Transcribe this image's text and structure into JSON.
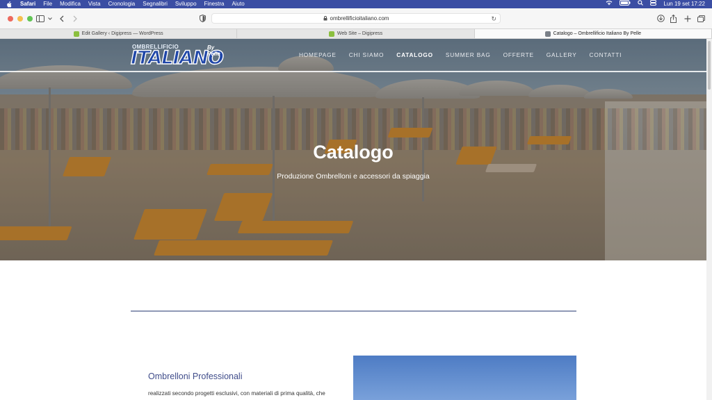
{
  "menubar": {
    "app": "Safari",
    "items": [
      "File",
      "Modifica",
      "Vista",
      "Cronologia",
      "Segnalibri",
      "Sviluppo",
      "Finestra",
      "Aiuto"
    ],
    "datetime": "Lun 19 set  17:22"
  },
  "toolbar": {
    "url": "ombrellificioitaliano.com"
  },
  "tabs": [
    {
      "label": "Edit Gallery ‹ Digipress — WordPress"
    },
    {
      "label": "Web Site – Digipress"
    },
    {
      "label": "Catalogo – Ombrellificio Italiano By Pelle"
    }
  ],
  "site": {
    "logo": {
      "top": "OMBRELLIFICIO",
      "main": "ITALIANO",
      "by": "By Pelle"
    },
    "nav": [
      "HOMEPAGE",
      "CHI SIAMO",
      "CATALOGO",
      "SUMMER BAG",
      "OFFERTE",
      "GALLERY",
      "CONTATTI"
    ],
    "hero_title": "Catalogo",
    "hero_subtitle": "Produzione Ombrelloni e accessori da spiaggia",
    "section_title": "Ombrelloni Professionali",
    "section_text": "realizzati secondo progetti esclusivi, con materiali di prima qualità, che"
  },
  "colors": {
    "menubar": "#3b4ea3",
    "accent": "#3f4c8a",
    "logo_blue": "#1f46a8"
  }
}
